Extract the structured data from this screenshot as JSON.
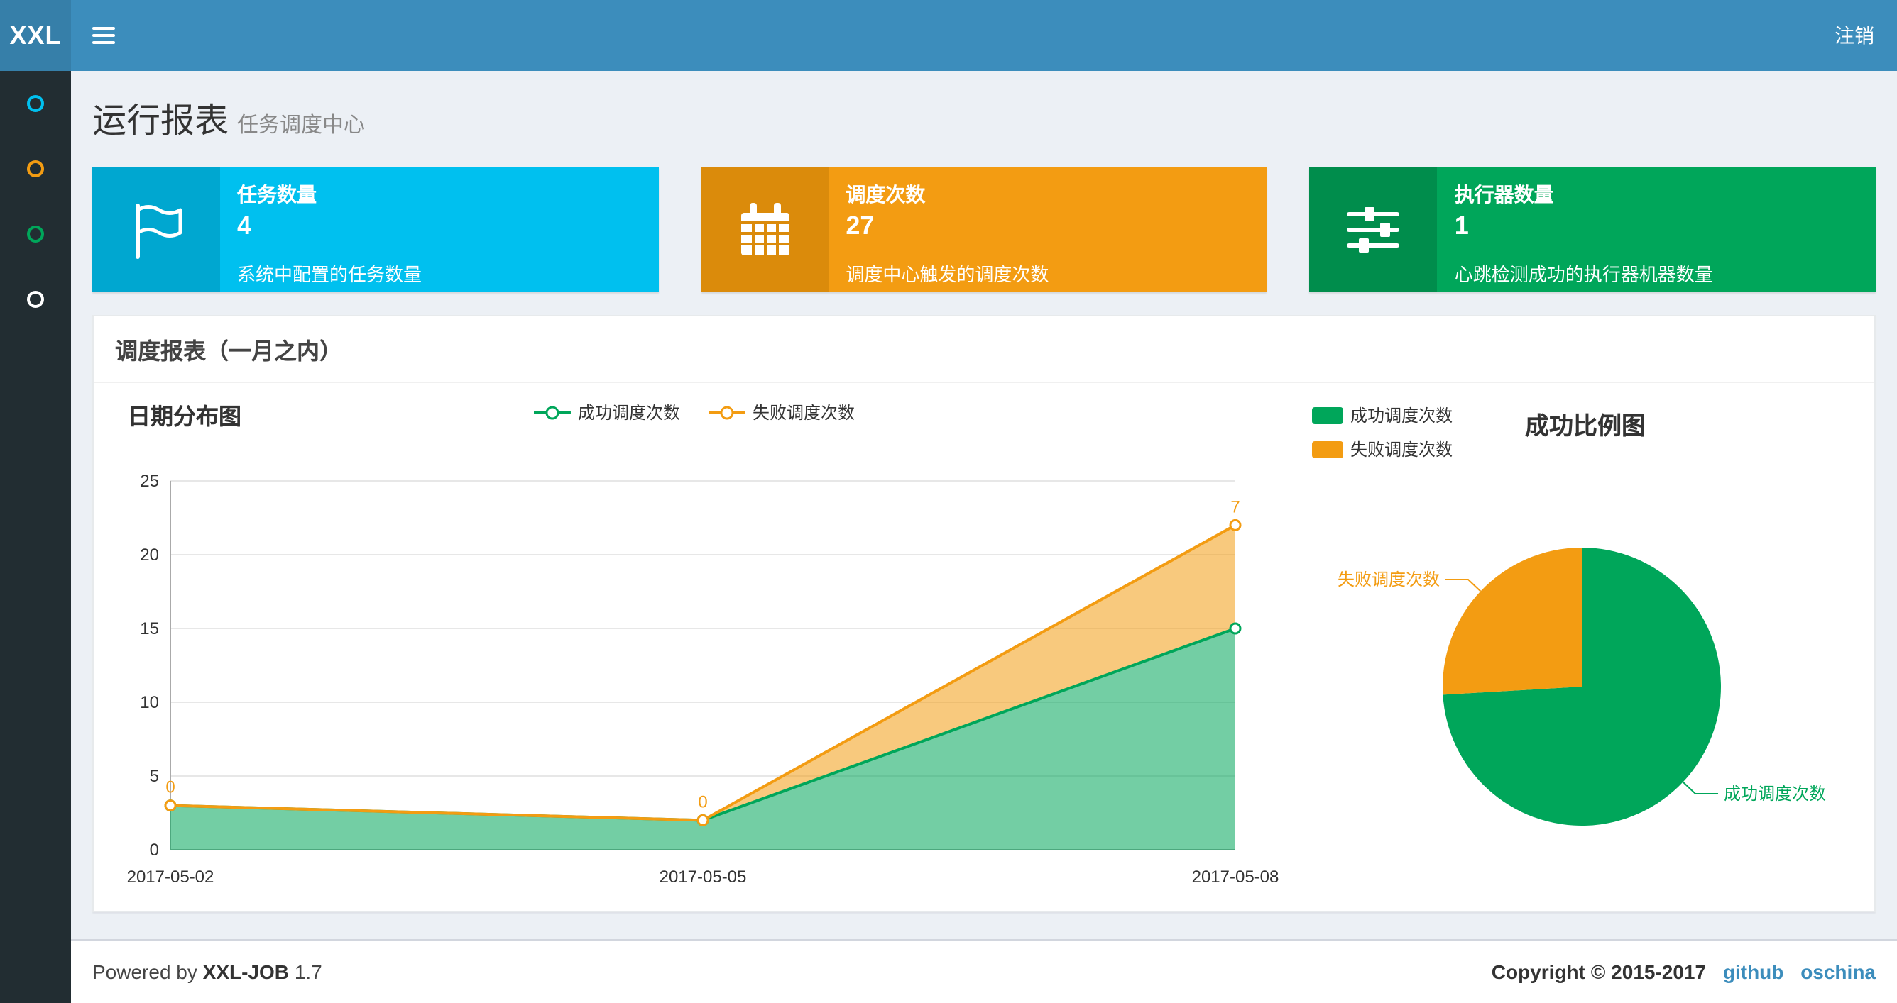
{
  "navbar": {
    "logo": "XXL",
    "logout_label": "注销"
  },
  "sidebar": {
    "items": [
      {
        "icon": "circle-icon",
        "color": "#00c0ef"
      },
      {
        "icon": "circle-icon",
        "color": "#f39c12"
      },
      {
        "icon": "circle-icon",
        "color": "#00a65a"
      },
      {
        "icon": "circle-icon",
        "color": "#ffffff"
      }
    ]
  },
  "page_header": {
    "title": "运行报表",
    "subtitle": "任务调度中心"
  },
  "info_boxes": [
    {
      "icon": "flag-icon",
      "label": "任务数量",
      "value": "4",
      "description": "系统中配置的任务数量",
      "bg": "#00c0ef",
      "icon_bg": "#00a7d0"
    },
    {
      "icon": "calendar-icon",
      "label": "调度次数",
      "value": "27",
      "description": "调度中心触发的调度次数",
      "bg": "#f39c12",
      "icon_bg": "#db8b0b"
    },
    {
      "icon": "sliders-icon",
      "label": "执行器数量",
      "value": "1",
      "description": "心跳检测成功的执行器机器数量",
      "bg": "#00a65a",
      "icon_bg": "#008d4c"
    }
  ],
  "panel": {
    "title": "调度报表（一月之内）"
  },
  "chart_data": [
    {
      "type": "area",
      "title": "日期分布图",
      "stacked": true,
      "grid": true,
      "legend_position": "top-center",
      "x": [
        "2017-05-02",
        "2017-05-05",
        "2017-05-08"
      ],
      "series": [
        {
          "name": "成功调度次数",
          "color": "#00a65a",
          "values": [
            3,
            2,
            15
          ]
        },
        {
          "name": "失败调度次数",
          "color": "#f39c12",
          "values": [
            0,
            0,
            7
          ],
          "point_labels": [
            "0",
            "0",
            "7"
          ]
        }
      ],
      "ylim": [
        0,
        25
      ],
      "yticks": [
        0,
        5,
        10,
        15,
        20,
        25
      ]
    },
    {
      "type": "pie",
      "title": "成功比例图",
      "legend_position": "top-left",
      "slices": [
        {
          "name": "成功调度次数",
          "value": 20,
          "color": "#00a65a"
        },
        {
          "name": "失败调度次数",
          "value": 7,
          "color": "#f39c12"
        }
      ]
    }
  ],
  "footer": {
    "powered_by": "Powered by",
    "brand": "XXL-JOB",
    "version": "1.7",
    "copyright": "Copyright © 2015-2017",
    "links": [
      {
        "label": "github"
      },
      {
        "label": "oschina"
      }
    ]
  }
}
